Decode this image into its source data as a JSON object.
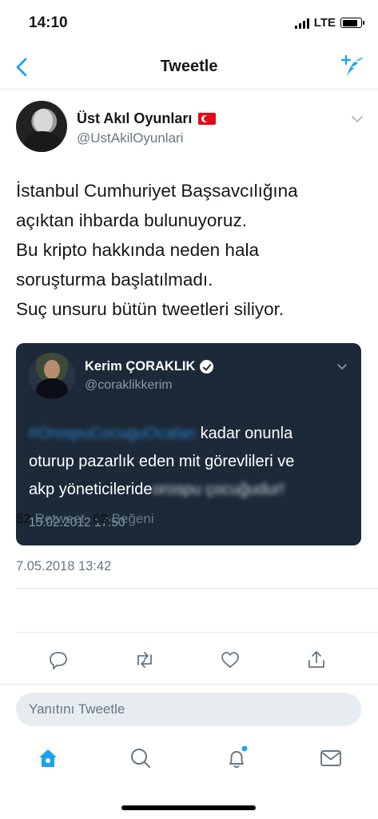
{
  "status_bar": {
    "time": "14:10",
    "network": "LTE",
    "battery_level": 0.85
  },
  "nav": {
    "title": "Tweetle",
    "back_icon": "chevron-left-icon",
    "compose_icon": "compose-tweet-icon",
    "accent_color": "#1da1f2"
  },
  "tweet": {
    "author_name": "Üst Akıl Oyunları",
    "author_handle": "@UstAkilOyunlari",
    "text_lines": [
      "İstanbul Cumhuriyet Başsavcılığına",
      "açıktan ihbarda bulunuyoruz.",
      "Bu kripto hakkında neden hala",
      "soruşturma başlatılmadı.",
      "Suç unsuru bütün tweetleri siliyor."
    ],
    "date": "7.05.2018 13:42",
    "retweet_count": "52",
    "retweet_label": "Retweet",
    "like_count": "68",
    "like_label": "Beğeni"
  },
  "quoted_tweet": {
    "author_name": "Kerim ÇORAKLIK",
    "author_handle": "@coraklikkerim",
    "line1_blurred": "#OrospuCocuguOcalan",
    "line1_text": "kadar onunla",
    "line2_text": "oturup pazarlık eden mit görevlileri ve",
    "line3_text": "akp yöneticileride",
    "line3_blurred": "orospu çocuğudur!",
    "date": "15.02.2012 17:50"
  },
  "reply": {
    "placeholder": "Yanıtını Tweetle"
  },
  "tabs": [
    "home-icon",
    "search-icon",
    "notifications-icon",
    "messages-icon"
  ]
}
